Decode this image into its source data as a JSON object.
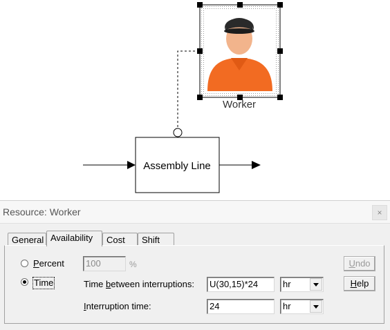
{
  "canvas": {
    "worker_label": "Worker",
    "process_label": "Assembly Line"
  },
  "dialog": {
    "title": "Resource: Worker",
    "close_glyph": "×",
    "tabs": [
      {
        "label": "General",
        "active": false
      },
      {
        "label": "Availability",
        "active": true
      },
      {
        "label": "Cost",
        "active": false
      },
      {
        "label": "Shift",
        "active": false
      }
    ],
    "mode": {
      "percent_label": "Percent",
      "time_label": "Time",
      "selected": "time"
    },
    "percent": {
      "value": "100",
      "unit": "%"
    },
    "time_between_label": "Time between interruptions:",
    "time_between_value": "U(30,15)*24",
    "time_between_unit": "hr",
    "interruption_time_label": "Interruption time:",
    "interruption_time_value": "24",
    "interruption_time_unit": "hr",
    "undo_label": "Undo",
    "help_label": "Help"
  },
  "colors": {
    "worker_shirt": "#f26b22",
    "worker_cap": "#2a2a2a",
    "worker_skin": "#f2b48c"
  }
}
